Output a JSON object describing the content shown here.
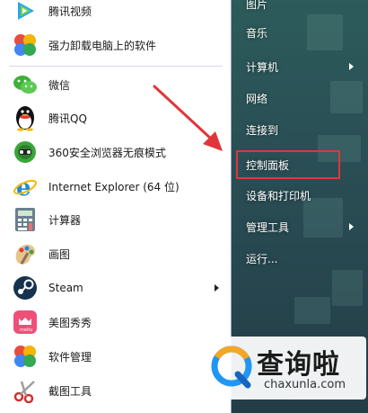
{
  "start_menu": {
    "programs": [
      {
        "label": "腾讯视频",
        "icon": "tencent-video-icon",
        "has_submenu": false
      },
      {
        "label": "强力卸载电脑上的软件",
        "icon": "uninstaller-clover-icon",
        "has_submenu": false
      },
      {
        "label": "微信",
        "icon": "wechat-icon",
        "has_submenu": false
      },
      {
        "label": "腾讯QQ",
        "icon": "qq-penguin-icon",
        "has_submenu": false
      },
      {
        "label": "360安全浏览器无痕模式",
        "icon": "360-browser-icon",
        "has_submenu": false
      },
      {
        "label": "Internet Explorer (64 位)",
        "icon": "internet-explorer-icon",
        "has_submenu": false
      },
      {
        "label": "计算器",
        "icon": "calculator-icon",
        "has_submenu": false
      },
      {
        "label": "画图",
        "icon": "paint-icon",
        "has_submenu": false
      },
      {
        "label": "Steam",
        "icon": "steam-icon",
        "has_submenu": true
      },
      {
        "label": "美图秀秀",
        "icon": "meitu-icon",
        "has_submenu": false
      },
      {
        "label": "软件管理",
        "icon": "software-manager-icon",
        "has_submenu": false
      },
      {
        "label": "截图工具",
        "icon": "snipping-tool-icon",
        "has_submenu": false
      }
    ],
    "places": [
      {
        "label": "图片",
        "has_submenu": false
      },
      {
        "label": "音乐",
        "has_submenu": false
      },
      {
        "label": "计算机",
        "has_submenu": true
      },
      {
        "label": "网络",
        "has_submenu": false
      },
      {
        "label": "连接到",
        "has_submenu": false
      },
      {
        "label": "控制面板",
        "has_submenu": false,
        "highlighted": true
      },
      {
        "label": "设备和打印机",
        "has_submenu": false
      },
      {
        "label": "管理工具",
        "has_submenu": true
      },
      {
        "label": "运行...",
        "has_submenu": false
      }
    ]
  },
  "watermark": {
    "brand_cn": "查询啦",
    "brand_en": "chaxunla.com"
  },
  "colors": {
    "highlight_border": "#e2353b",
    "annotation_arrow": "#e2353b",
    "right_panel": "#2a4e55"
  }
}
